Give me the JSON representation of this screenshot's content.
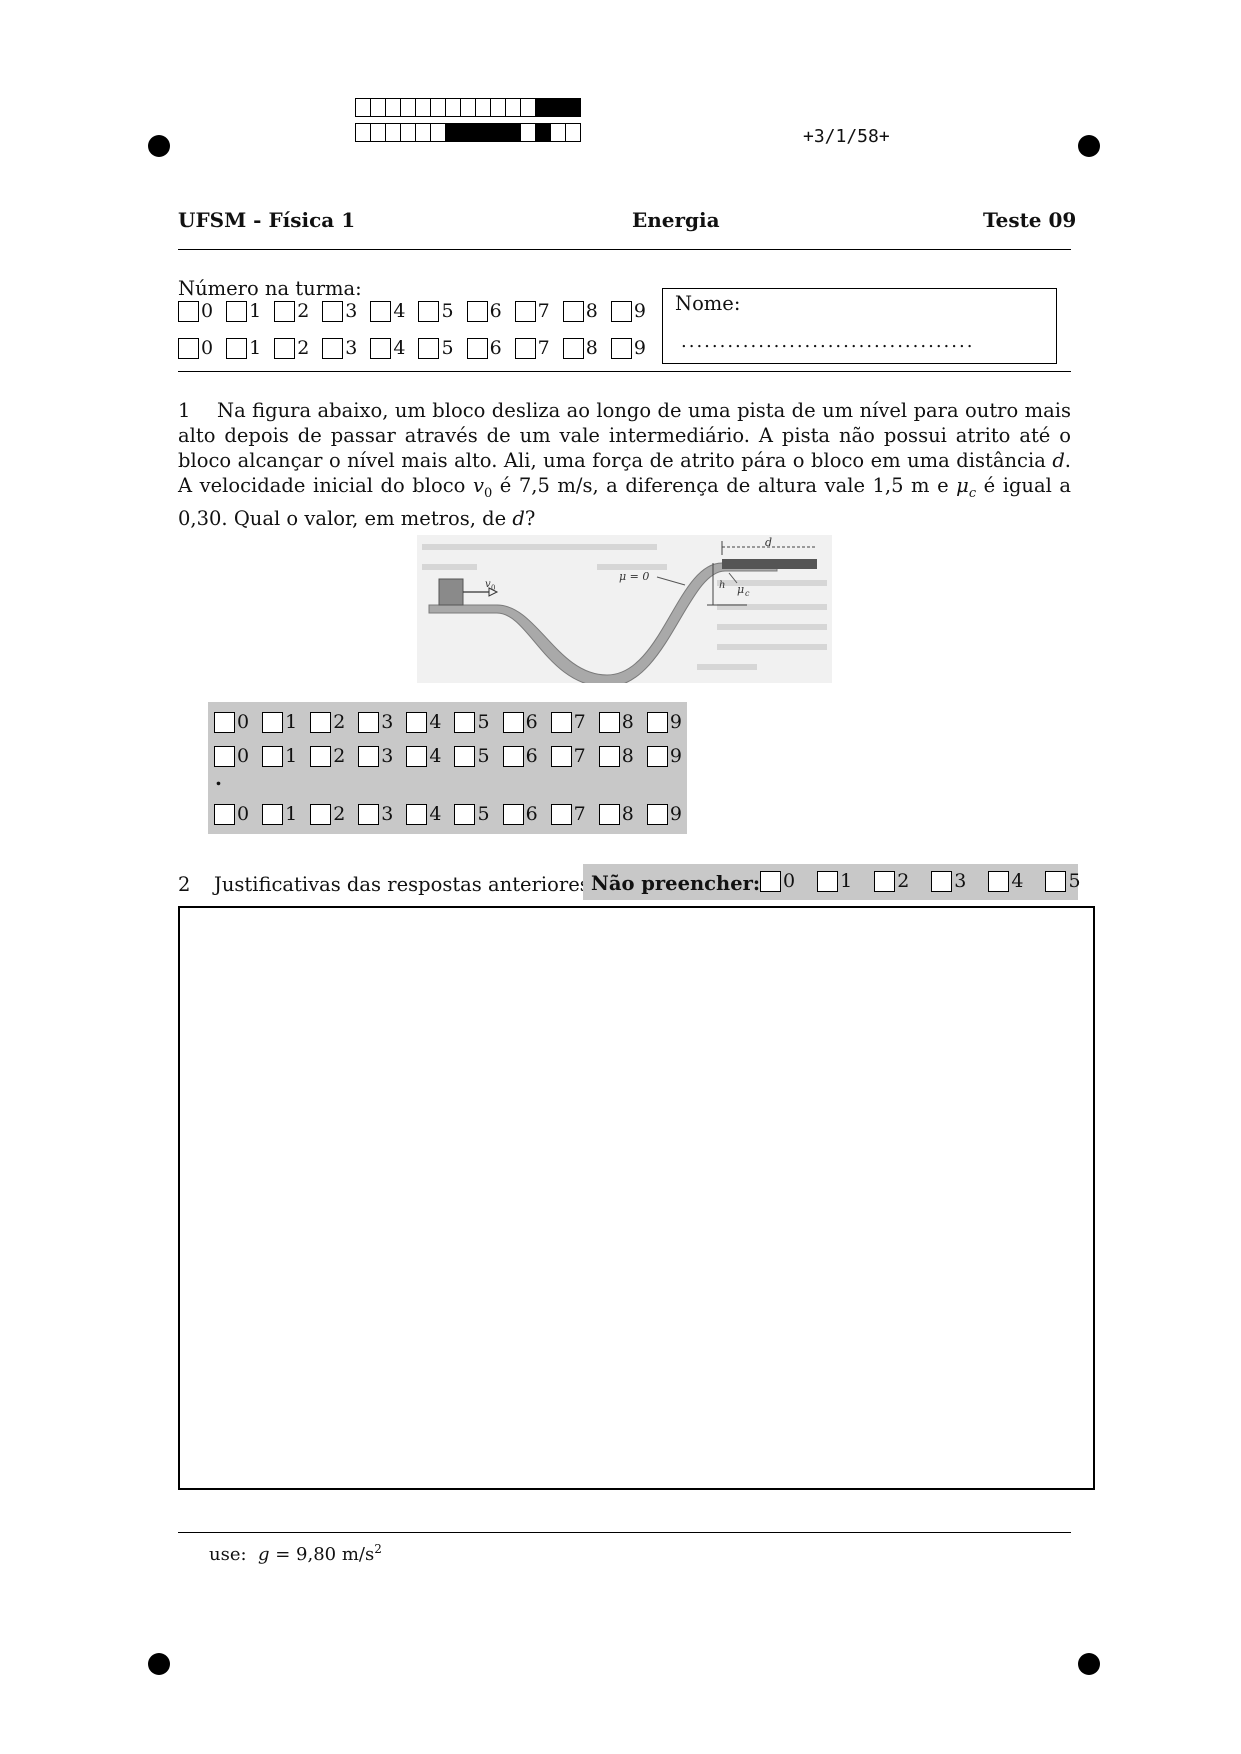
{
  "header": {
    "code": "+3/1/58+",
    "left": "UFSM - Física 1",
    "center": "Energia",
    "right": "Teste 09"
  },
  "id_section": {
    "label": "Número na turma:",
    "digits": [
      "0",
      "1",
      "2",
      "3",
      "4",
      "5",
      "6",
      "7",
      "8",
      "9"
    ],
    "name_label": "Nome:",
    "name_dots": "......................................"
  },
  "question1": {
    "number": "1",
    "text_a": "Na figura abaixo, um bloco desliza ao longo de uma pista de um nível para outro mais alto depois de passar através de um vale intermediário. A pista não possui atrito até o bloco alcançar o nível mais alto. Ali, uma força de atrito pára o bloco em uma distância ",
    "text_d": "d",
    "text_b": ". A velocidade inicial do bloco ",
    "text_v": "v",
    "text_v_sub": "0",
    "text_c": " é 7,5 m/s, a diferença de altura vale 1,5 m e ",
    "text_mu": "μ",
    "text_mu_sub": "c",
    "text_e": " é igual a 0,30. Qual o valor, em metros, de ",
    "text_d2": "d",
    "text_f": "?",
    "figure": {
      "mu0": "μ = 0",
      "d_label": "d",
      "h_label": "h",
      "muc": "μ",
      "muc_sub": "c",
      "v_label": "v",
      "v_sub": "0"
    },
    "answer_digits": [
      "0",
      "1",
      "2",
      "3",
      "4",
      "5",
      "6",
      "7",
      "8",
      "9"
    ],
    "decimal_point": "."
  },
  "question2": {
    "number": "2",
    "label": "Justificativas das respostas anteriores:",
    "no_fill_label": "Não preencher:",
    "no_fill_digits": [
      "0",
      "1",
      "2",
      "3",
      "4",
      "5"
    ]
  },
  "footer": {
    "use_label": "use:",
    "g": "g",
    "eq": " = 9,80 m/s",
    "sup": "2"
  }
}
